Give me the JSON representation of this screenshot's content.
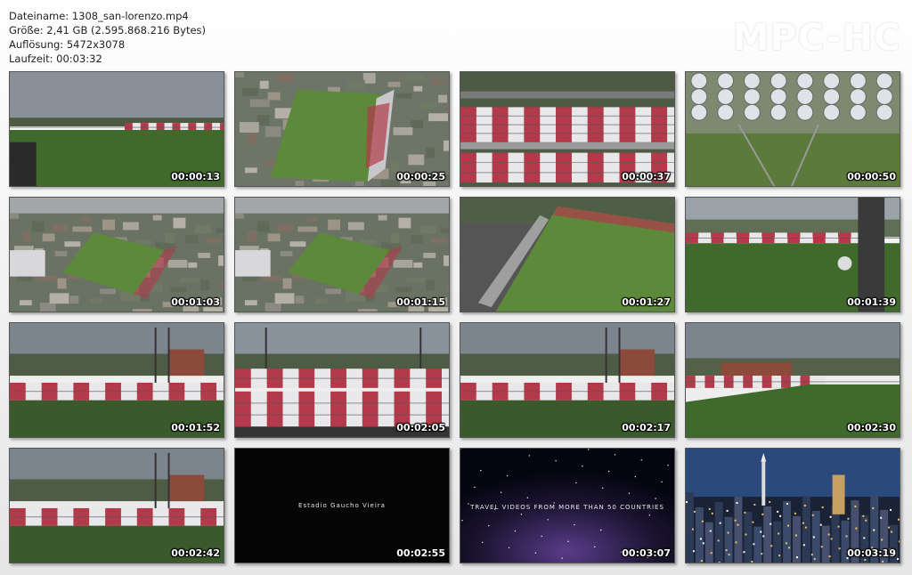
{
  "info": {
    "filename": "Dateiname: 1308_san-lorenzo.mp4",
    "size": "Größe: 2,41 GB (2.595.868.216 Bytes)",
    "resolution": "Auflösung: 5472x3078",
    "duration": "Laufzeit: 00:03:32"
  },
  "logo": "MPC-HC",
  "thumbnails": [
    {
      "time": "00:00:13",
      "scene": "stadium-low-angle"
    },
    {
      "time": "00:00:25",
      "scene": "stadium-aerial"
    },
    {
      "time": "00:00:37",
      "scene": "stands-topdown"
    },
    {
      "time": "00:00:50",
      "scene": "floodlights-closeup"
    },
    {
      "time": "00:01:03",
      "scene": "stadium-aerial-city"
    },
    {
      "time": "00:01:15",
      "scene": "stadium-aerial-city"
    },
    {
      "time": "00:01:27",
      "scene": "field-aerial-tilted"
    },
    {
      "time": "00:01:39",
      "scene": "field-with-light-tower"
    },
    {
      "time": "00:01:52",
      "scene": "stands-side-view"
    },
    {
      "time": "00:02:05",
      "scene": "stands-front-view"
    },
    {
      "time": "00:02:17",
      "scene": "stands-side-view"
    },
    {
      "time": "00:02:30",
      "scene": "field-ground-view"
    },
    {
      "time": "00:02:42",
      "scene": "stands-side-view"
    },
    {
      "time": "00:02:55",
      "scene": "black-title",
      "caption": "Estadio Gaucho Vieira"
    },
    {
      "time": "00:03:07",
      "scene": "space-title",
      "caption": "TRAVEL VIDEOS FROM MORE THAN 50 COUNTRIES"
    },
    {
      "time": "00:03:19",
      "scene": "city-night"
    }
  ]
}
